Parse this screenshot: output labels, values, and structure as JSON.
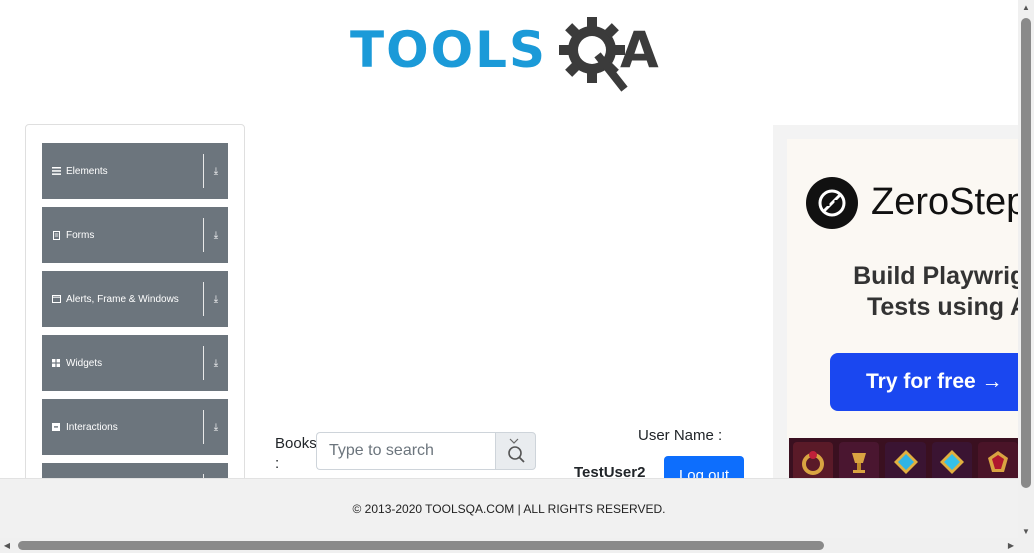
{
  "header": {
    "logo_part1": "TOOLS",
    "logo_part2": "A",
    "logo_alt": "TOOLSQA"
  },
  "sidebar": {
    "groups": [
      {
        "label": "Elements",
        "icon": "hamburger-icon"
      },
      {
        "label": "Forms",
        "icon": "document-icon"
      },
      {
        "label": "Alerts, Frame & Windows",
        "icon": "window-icon"
      },
      {
        "label": "Widgets",
        "icon": "grid-icon"
      },
      {
        "label": "Interactions",
        "icon": "square-icon"
      },
      {
        "label": "",
        "icon": ""
      }
    ]
  },
  "books": {
    "label": "Books :",
    "search_placeholder": "Type to search",
    "search_value": ""
  },
  "user": {
    "label": "User Name :",
    "value": "TestUser2",
    "logout_label": "Log out"
  },
  "ad": {
    "brand": "ZeroStep",
    "headline": "Build Playwright\nTests using AI",
    "cta": "Try for free →"
  },
  "footer": {
    "text": "© 2013-2020 TOOLSQA.COM | ALL RIGHTS RESERVED."
  },
  "colors": {
    "brand_blue": "#1b9ad8",
    "group_bg": "#6c757d",
    "primary": "#0d6efd",
    "ad_cta": "#1a47f0"
  }
}
